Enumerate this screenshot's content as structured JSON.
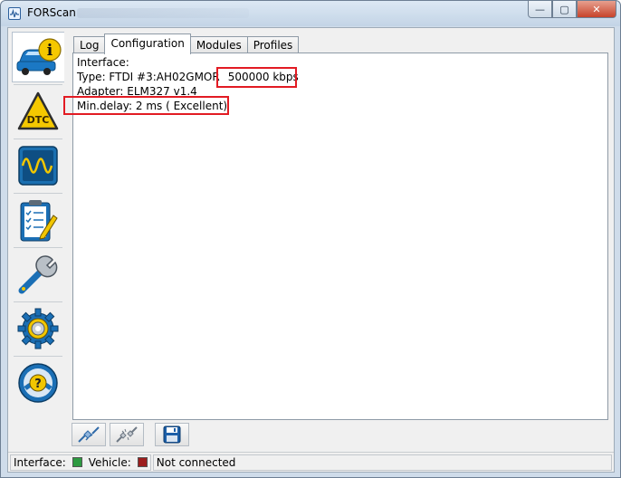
{
  "window": {
    "title": "FORScan",
    "controls": {
      "minimize": "—",
      "maximize": "▢",
      "close": "✕"
    }
  },
  "sidebar": {
    "items": [
      {
        "name": "vehicle-info",
        "active": true
      },
      {
        "name": "dtc",
        "label": "DTC"
      },
      {
        "name": "oscilloscope"
      },
      {
        "name": "tests-checklist"
      },
      {
        "name": "service-functions"
      },
      {
        "name": "settings"
      },
      {
        "name": "help"
      }
    ]
  },
  "tabs": [
    {
      "label": "Log",
      "active": false
    },
    {
      "label": "Configuration",
      "active": true
    },
    {
      "label": "Modules",
      "active": false
    },
    {
      "label": "Profiles",
      "active": false
    }
  ],
  "configuration": {
    "interface_label": "Interface:",
    "type_prefix": "Type: FTDI #3:AH02GMOR",
    "type_speed": "500000 kbps",
    "adapter": "Adapter: ELM327 v1.4",
    "min_delay": "Min.delay: 2 ms ( Excellent)"
  },
  "toolbar": {
    "buttons": [
      {
        "name": "connect-vehicle"
      },
      {
        "name": "disconnect-vehicle"
      },
      {
        "name": "save"
      }
    ]
  },
  "status": {
    "interface_label": "Interface:",
    "interface_color": "#2e9a41",
    "vehicle_label": "Vehicle:",
    "vehicle_color": "#9c1d1d",
    "connection_text": "Not connected"
  },
  "colors": {
    "highlight": "#e21b23",
    "titlebar": "#cfdcea"
  }
}
